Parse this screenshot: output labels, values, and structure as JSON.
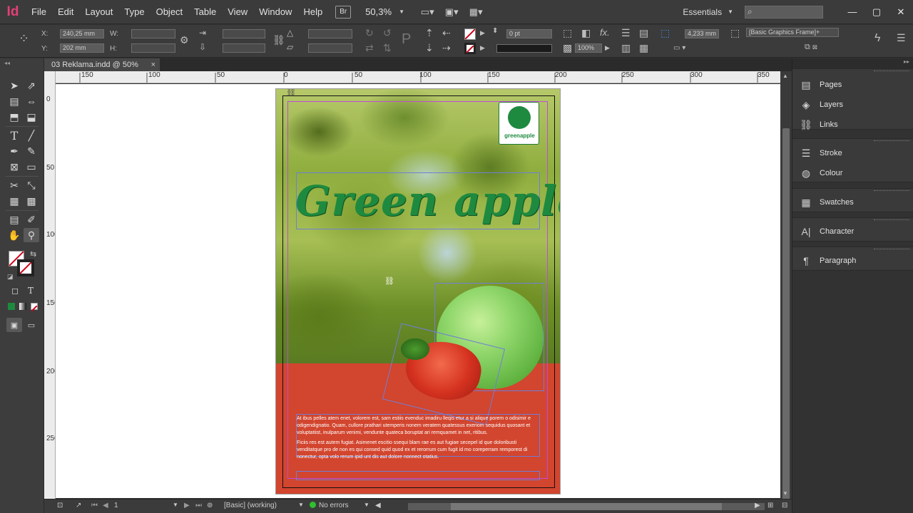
{
  "app": {
    "logo": "Id"
  },
  "menu": [
    "File",
    "Edit",
    "Layout",
    "Type",
    "Object",
    "Table",
    "View",
    "Window",
    "Help"
  ],
  "toolbar": {
    "bridge": "Br",
    "zoom": "50,3%",
    "workspace": "Essentials"
  },
  "control": {
    "x": "240,25 mm",
    "y": "202 mm",
    "x_label": "X:",
    "y_label": "Y:",
    "w_label": "W:",
    "h_label": "H:",
    "stroke_weight": "0 pt",
    "opacity": "100%",
    "fit_value": "4,233 mm",
    "object_style": "[Basic Graphics Frame]+"
  },
  "document_tab": {
    "title": "03 Reklama.indd @ 50%",
    "close": "×"
  },
  "ruler": {
    "h_labels": [
      "150",
      "100",
      "50",
      "0",
      "50",
      "100",
      "150",
      "200",
      "250",
      "300",
      "350"
    ],
    "v_labels": [
      "0",
      "50",
      "100",
      "150",
      "200",
      "250"
    ]
  },
  "page": {
    "headline": "Green apple",
    "logo_text": "greenapple",
    "body": [
      "At ibus pelles atem enet, volorem est, sam estiis evenduc imadiru lleqis etur a si alique porem o odisimir e odigendignatio. Quam, cullore prathari utemperis nonem veratem quatessus exeriom sequidus quosant et voluptatiist, inulparum venimi, vendunte quateca boruptat ari remquamet in net, ritibus.",
      "Ficiis res est autem fugiat. Asimenet escitio ssequi blam rae es aut fugiae secepel id que doloribusti venditatque pro de non es qui consed quid quod ex et rerorrum cum fugit id mo coreperram remporest di nonectur, opta volo rerum ipid unt dis aut dolore nonnect otatius."
    ]
  },
  "status": {
    "page_number": "1",
    "preflight_profile": "[Basic] (working)",
    "errors": "No errors"
  },
  "panels": {
    "group1": [
      "Pages",
      "Layers",
      "Links"
    ],
    "group2": [
      "Stroke",
      "Colour"
    ],
    "group3": [
      "Swatches"
    ],
    "group4": [
      "Character"
    ],
    "group5": [
      "Paragraph"
    ]
  }
}
